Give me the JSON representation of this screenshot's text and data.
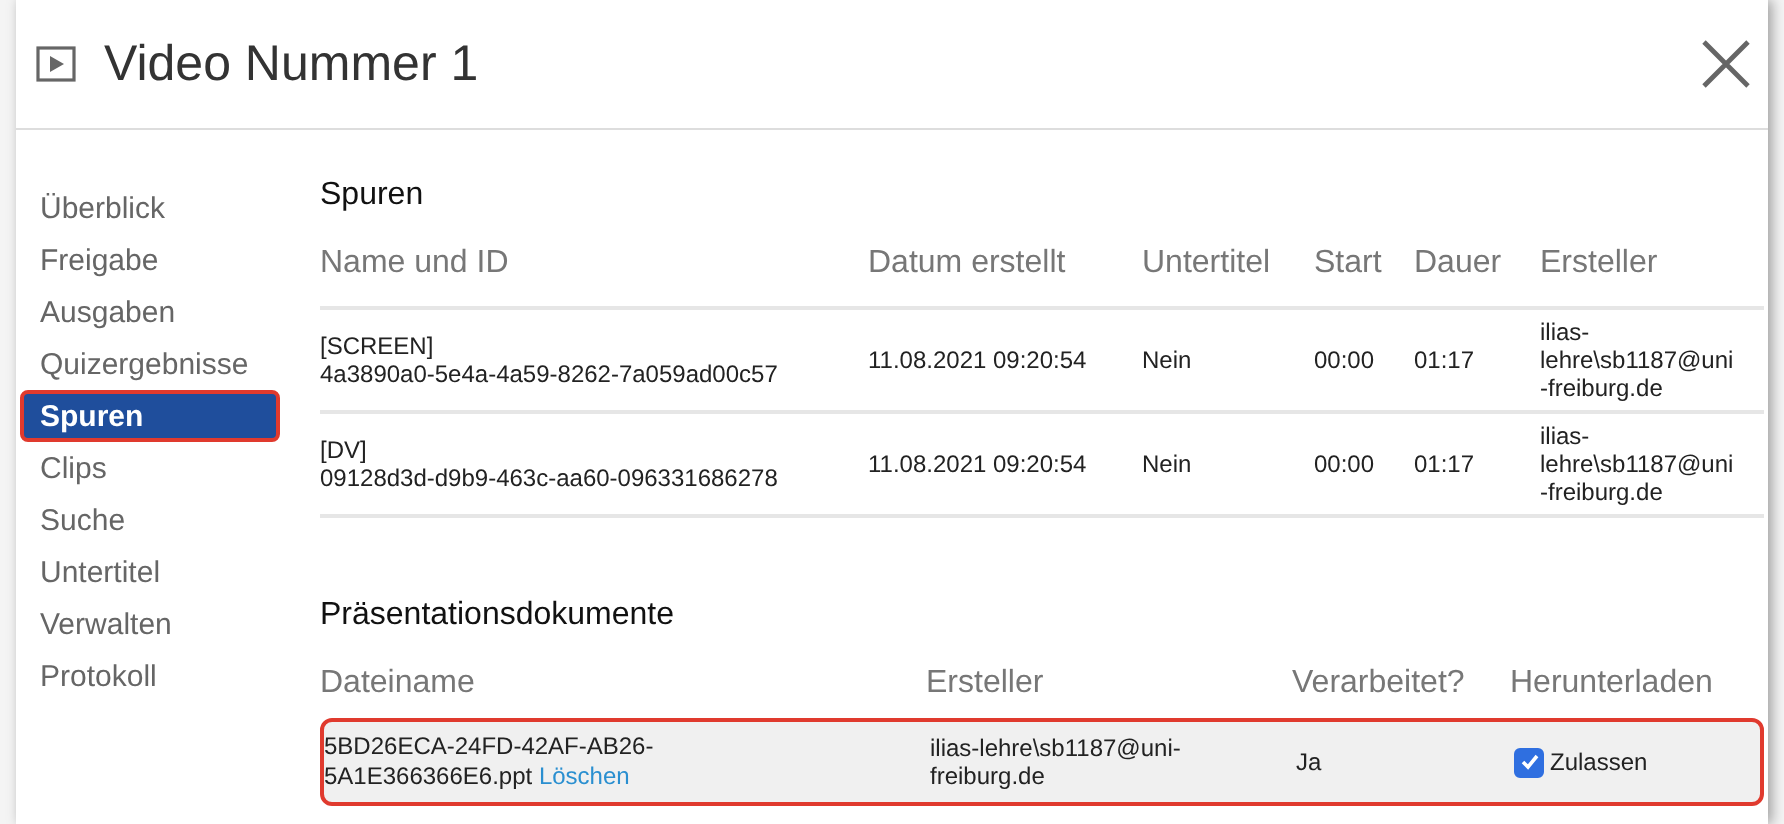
{
  "window": {
    "title": "Video Nummer 1"
  },
  "sidebar": {
    "items": [
      {
        "label": "Überblick",
        "selected": false
      },
      {
        "label": "Freigabe",
        "selected": false
      },
      {
        "label": "Ausgaben",
        "selected": false
      },
      {
        "label": "Quizergebnisse",
        "selected": false
      },
      {
        "label": "Spuren",
        "selected": true
      },
      {
        "label": "Clips",
        "selected": false
      },
      {
        "label": "Suche",
        "selected": false
      },
      {
        "label": "Untertitel",
        "selected": false
      },
      {
        "label": "Verwalten",
        "selected": false
      },
      {
        "label": "Protokoll",
        "selected": false
      }
    ]
  },
  "tracks": {
    "title": "Spuren",
    "columns": [
      "Name und ID",
      "Datum erstellt",
      "Untertitel",
      "Start",
      "Dauer",
      "Ersteller"
    ],
    "rows": [
      {
        "name": "[SCREEN]",
        "id": "4a3890a0-5e4a-4a59-8262-7a059ad00c57",
        "created": "11.08.2021 09:20:54",
        "subtitles": "Nein",
        "start": "00:00",
        "duration": "01:17",
        "creator": "ilias-lehre\\sb1187@uni-freiburg.de"
      },
      {
        "name": "[DV]",
        "id": "09128d3d-d9b9-463c-aa60-096331686278",
        "created": "11.08.2021 09:20:54",
        "subtitles": "Nein",
        "start": "00:00",
        "duration": "01:17",
        "creator": "ilias-lehre\\sb1187@uni-freiburg.de"
      }
    ]
  },
  "documents": {
    "title": "Präsentationsdokumente",
    "columns": [
      "Dateiname",
      "Ersteller",
      "Verarbeitet?",
      "Herunterladen"
    ],
    "rows": [
      {
        "file": "5BD26ECA-24FD-42AF-AB26-5A1E366366E6.ppt",
        "delete_link": "Löschen",
        "creator": "ilias-lehre\\sb1187@uni-freiburg.de",
        "processed": "Ja",
        "download_label": "Zulassen",
        "download_allowed": true,
        "highlighted": true
      }
    ]
  }
}
